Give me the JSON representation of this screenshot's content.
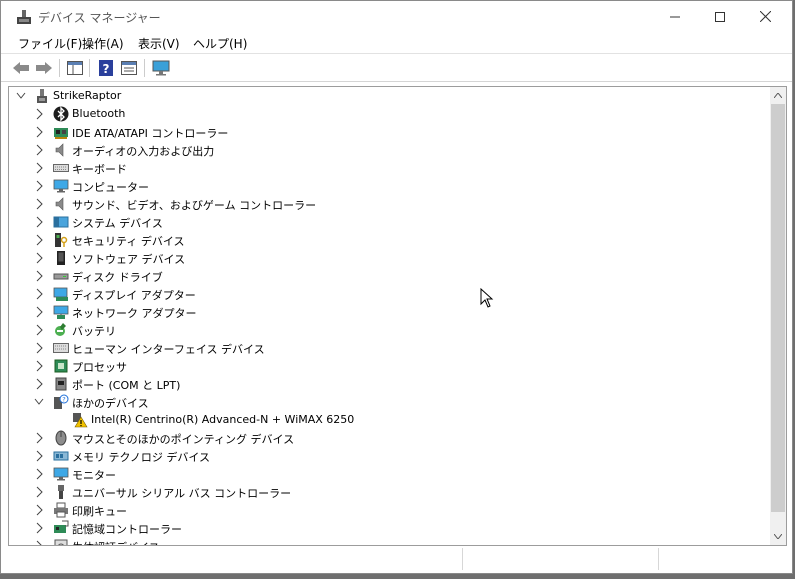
{
  "window": {
    "title": "デバイス マネージャー"
  },
  "menu": [
    {
      "label": "ファイル(F)"
    },
    {
      "label": "操作(A)"
    },
    {
      "label": "表示(V)"
    },
    {
      "label": "ヘルプ(H)"
    }
  ],
  "toolbar": {
    "icons": [
      "back-icon",
      "forward-icon",
      "show-hide-tree-icon",
      "help-icon",
      "properties-icon",
      "scan-hardware-icon"
    ]
  },
  "tree": {
    "root": {
      "label": "StrikeRaptor",
      "icon": "computer-root-icon"
    },
    "items": [
      {
        "label": "Bluetooth",
        "icon": "bluetooth-icon"
      },
      {
        "label": "IDE ATA/ATAPI コントローラー",
        "icon": "ide-controller-icon"
      },
      {
        "label": "オーディオの入力および出力",
        "icon": "speaker-icon"
      },
      {
        "label": "キーボード",
        "icon": "keyboard-icon"
      },
      {
        "label": "コンピューター",
        "icon": "monitor-icon"
      },
      {
        "label": "サウンド、ビデオ、およびゲーム コントローラー",
        "icon": "speaker-icon"
      },
      {
        "label": "システム デバイス",
        "icon": "system-device-icon"
      },
      {
        "label": "セキュリティ デバイス",
        "icon": "security-key-icon"
      },
      {
        "label": "ソフトウェア デバイス",
        "icon": "software-device-icon"
      },
      {
        "label": "ディスク ドライブ",
        "icon": "disk-drive-icon"
      },
      {
        "label": "ディスプレイ アダプター",
        "icon": "display-adapter-icon"
      },
      {
        "label": "ネットワーク アダプター",
        "icon": "network-adapter-icon"
      },
      {
        "label": "バッテリ",
        "icon": "battery-icon"
      },
      {
        "label": "ヒューマン インターフェイス デバイス",
        "icon": "hid-icon"
      },
      {
        "label": "プロセッサ",
        "icon": "processor-icon"
      },
      {
        "label": "ポート (COM と LPT)",
        "icon": "port-icon"
      },
      {
        "label": "ほかのデバイス",
        "icon": "unknown-device-icon",
        "expanded": true,
        "children": [
          {
            "label": "Intel(R) Centrino(R) Advanced-N + WiMAX 6250",
            "icon": "warning-device-icon"
          }
        ]
      },
      {
        "label": "マウスとそのほかのポインティング デバイス",
        "icon": "mouse-icon"
      },
      {
        "label": "メモリ テクノロジ デバイス",
        "icon": "memory-icon"
      },
      {
        "label": "モニター",
        "icon": "monitor-icon"
      },
      {
        "label": "ユニバーサル シリアル バス コントローラー",
        "icon": "usb-icon"
      },
      {
        "label": "印刷キュー",
        "icon": "printer-icon"
      },
      {
        "label": "記憶域コントローラー",
        "icon": "storage-controller-icon"
      },
      {
        "label": "生体認証デバイス",
        "icon": "biometric-icon"
      }
    ]
  },
  "colors": {
    "accent": "#1e90ff",
    "warning": "#f2c200"
  }
}
